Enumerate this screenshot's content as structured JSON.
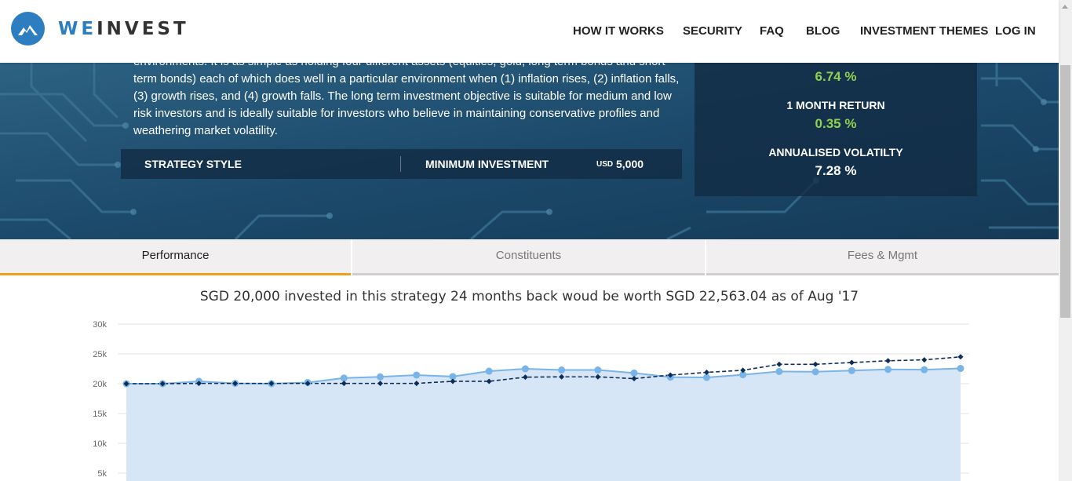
{
  "brand": {
    "we": "WE",
    "rest": "INVEST"
  },
  "nav": [
    "HOW IT WORKS",
    "SECURITY",
    "FAQ",
    "BLOG",
    "INVESTMENT THEMES",
    "LOG IN"
  ],
  "hero": {
    "description": "environments. It is as simple as holding four different assets (equities, gold, long term bonds and short term bonds) each of which does well in a particular environment when (1) inflation rises, (2) inflation falls,(3) growth rises, and (4) growth falls. The long term investment objective is suitable for medium and low risk investors and is ideally suitable for investors who believe in maintaining conservative profiles and weathering market volatility.",
    "strategy_style_label": "STRATEGY STYLE",
    "min_investment_label": "MINIMUM INVESTMENT",
    "min_investment_currency": "USD",
    "min_investment_value": "5,000"
  },
  "stats": {
    "first_value": "6.74 %",
    "one_month_label": "1 MONTH RETURN",
    "one_month_value": "0.35 %",
    "volatility_label": "ANNUALISED VOLATILTY",
    "volatility_value": "7.28 %"
  },
  "tabs": [
    "Performance",
    "Constituents",
    "Fees & Mgmt"
  ],
  "active_tab": "Performance",
  "colors": {
    "brand_blue": "#2c7ec0",
    "accent_orange": "#f0a01e",
    "positive_green": "#8fd14f",
    "series_light": "#79b4e8",
    "series_dark": "#0d2c56",
    "area_fill": "#d6e6f7"
  },
  "chart_title": "SGD 20,000 invested in this strategy 24 months back woud be worth SGD 22,563.04 as of Aug '17",
  "chart_data": {
    "type": "line",
    "ytick_labels": [
      "30k",
      "25k",
      "20k",
      "15k",
      "10k",
      "5k"
    ],
    "ylim": [
      0,
      30000
    ],
    "grid": true,
    "series": [
      {
        "style": "area-solid-light",
        "values": [
          20000,
          20000,
          20400,
          20050,
          20000,
          20200,
          20950,
          21150,
          21450,
          21200,
          22100,
          22500,
          22300,
          22300,
          21800,
          21100,
          21050,
          21500,
          22050,
          22000,
          22200,
          22400,
          22350,
          22563
        ]
      },
      {
        "style": "dashed-dark",
        "values": [
          20000,
          20000,
          20050,
          20050,
          20050,
          20050,
          20050,
          20050,
          20050,
          20400,
          20400,
          21100,
          21150,
          21150,
          20850,
          21450,
          21900,
          22250,
          23250,
          23250,
          23550,
          23850,
          24000,
          24500
        ]
      }
    ]
  }
}
